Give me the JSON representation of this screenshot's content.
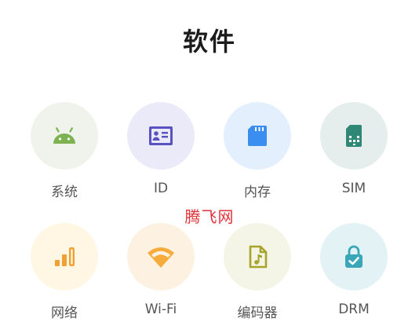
{
  "header": {
    "title": "软件"
  },
  "items": [
    {
      "label": "系统",
      "icon": "android-icon",
      "bg": "#eff3ec",
      "color": "#7cb24f"
    },
    {
      "label": "ID",
      "icon": "id-card-icon",
      "bg": "#ebeaf8",
      "color": "#5a52bf"
    },
    {
      "label": "内存",
      "icon": "memory-card-icon",
      "bg": "#e3effc",
      "color": "#3a8ef0"
    },
    {
      "label": "SIM",
      "icon": "sim-card-icon",
      "bg": "#e5eeec",
      "color": "#2f8775"
    },
    {
      "label": "网络",
      "icon": "signal-bars-icon",
      "bg": "#fff6e4",
      "color": "#f0a132"
    },
    {
      "label": "Wi-Fi",
      "icon": "wifi-icon",
      "bg": "#fdf1e2",
      "color": "#f5ac3b"
    },
    {
      "label": "编码器",
      "icon": "music-file-icon",
      "bg": "#f4f5e6",
      "color": "#a6a52a"
    },
    {
      "label": "DRM",
      "icon": "lock-check-icon",
      "bg": "#e3f2f5",
      "color": "#3aa7b8"
    }
  ],
  "watermark": {
    "text": "腾飞网"
  }
}
